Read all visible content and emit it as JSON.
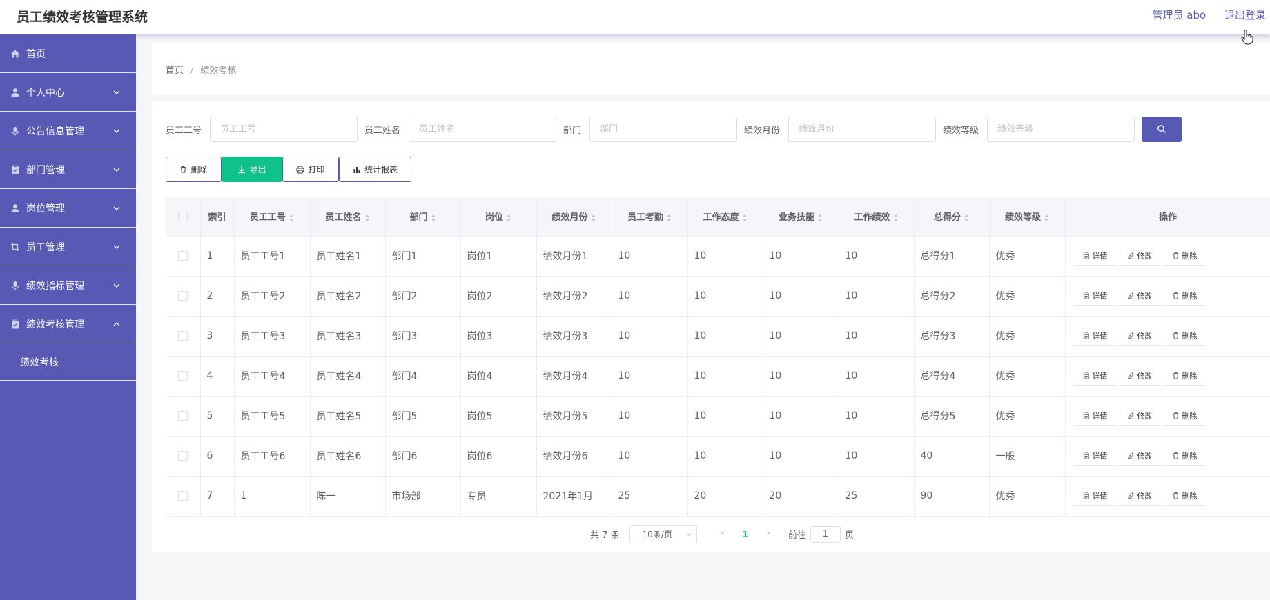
{
  "header": {
    "title": "员工绩效考核管理系统",
    "admin_label": "管理员 abo",
    "logout_label": "退出登录"
  },
  "sidebar": {
    "items": [
      {
        "label": "首页",
        "icon": "home-icon",
        "expandable": false
      },
      {
        "label": "个人中心",
        "icon": "user-icon",
        "expandable": true
      },
      {
        "label": "公告信息管理",
        "icon": "mic-icon",
        "expandable": true
      },
      {
        "label": "部门管理",
        "icon": "clipboard-icon",
        "expandable": true
      },
      {
        "label": "岗位管理",
        "icon": "user-icon",
        "expandable": true
      },
      {
        "label": "员工管理",
        "icon": "crop-icon",
        "expandable": true
      },
      {
        "label": "绩效指标管理",
        "icon": "mic-icon",
        "expandable": true
      },
      {
        "label": "绩效考核管理",
        "icon": "clipboard-icon",
        "expandable": true,
        "expanded": true
      }
    ],
    "submenu_label": "绩效考核"
  },
  "breadcrumb": {
    "home": "首页",
    "separator": "/",
    "current": "绩效考核"
  },
  "search": {
    "emp_no_label": "员工工号",
    "emp_no_placeholder": "员工工号",
    "emp_name_label": "员工姓名",
    "emp_name_placeholder": "员工姓名",
    "dept_label": "部门",
    "dept_placeholder": "部门",
    "month_label": "绩效月份",
    "month_placeholder": "绩效月份",
    "grade_label": "绩效等级",
    "grade_placeholder": "绩效等级"
  },
  "toolbar": {
    "delete_label": "删除",
    "export_label": "导出",
    "print_label": "打印",
    "report_label": "统计报表"
  },
  "table": {
    "columns": [
      "索引",
      "员工工号",
      "员工姓名",
      "部门",
      "岗位",
      "绩效月份",
      "员工考勤",
      "工作态度",
      "业务技能",
      "工作绩效",
      "总得分",
      "绩效等级",
      "操作"
    ],
    "rows": [
      [
        "1",
        "员工工号1",
        "员工姓名1",
        "部门1",
        "岗位1",
        "绩效月份1",
        "10",
        "10",
        "10",
        "10",
        "总得分1",
        "优秀"
      ],
      [
        "2",
        "员工工号2",
        "员工姓名2",
        "部门2",
        "岗位2",
        "绩效月份2",
        "10",
        "10",
        "10",
        "10",
        "总得分2",
        "优秀"
      ],
      [
        "3",
        "员工工号3",
        "员工姓名3",
        "部门3",
        "岗位3",
        "绩效月份3",
        "10",
        "10",
        "10",
        "10",
        "总得分3",
        "优秀"
      ],
      [
        "4",
        "员工工号4",
        "员工姓名4",
        "部门4",
        "岗位4",
        "绩效月份4",
        "10",
        "10",
        "10",
        "10",
        "总得分4",
        "优秀"
      ],
      [
        "5",
        "员工工号5",
        "员工姓名5",
        "部门5",
        "岗位5",
        "绩效月份5",
        "10",
        "10",
        "10",
        "10",
        "总得分5",
        "优秀"
      ],
      [
        "6",
        "员工工号6",
        "员工姓名6",
        "部门6",
        "岗位6",
        "绩效月份6",
        "10",
        "10",
        "10",
        "10",
        "40",
        "一般"
      ],
      [
        "7",
        "1",
        "陈一",
        "市场部",
        "专员",
        "2021年1月",
        "25",
        "20",
        "20",
        "25",
        "90",
        "优秀"
      ]
    ],
    "action_detail": "详情",
    "action_edit": "修改",
    "action_delete": "删除"
  },
  "pagination": {
    "total_text": "共 7 条",
    "page_size": "10条/页",
    "current_page": "1",
    "goto_label": "前往",
    "goto_value": "1",
    "page_suffix": "页"
  },
  "colors": {
    "primary": "#5759b5",
    "export_green": "#10c28a"
  }
}
